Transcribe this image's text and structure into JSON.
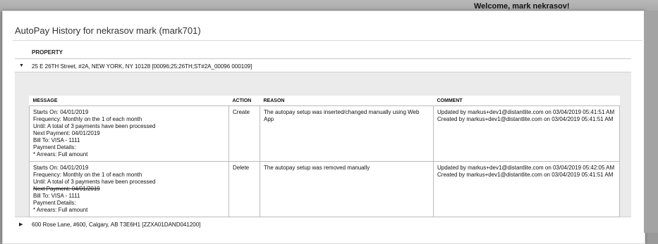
{
  "header": {
    "welcome": "Welcome, mark nekrasov!"
  },
  "modal": {
    "title": "AutoPay History for nekrasov mark (mark701)",
    "property_column_header": "PROPERTY"
  },
  "properties": [
    {
      "label": "25 E 26TH Street, #2A, NEW YORK, NY 10128 [00096;25;26TH;ST#2A_00096 000109]",
      "expanded": true
    },
    {
      "label": "600 Rose Lane, #600, Calgary, AB T3E6H1 [ZZXA01DAND041200]",
      "expanded": false
    }
  ],
  "history_table": {
    "columns": [
      "MESSAGE",
      "ACTION",
      "REASON",
      "COMMENT"
    ],
    "rows": [
      {
        "message": {
          "starts_on": "Starts On: 04/01/2019",
          "frequency": "Frequency: Monthly on the 1 of each month",
          "until": "Until: A total of 3 payments have been processed",
          "next_payment": "Next Payment: 04/01/2019",
          "bill_to": "Bill To: VISA - 1111",
          "payment_details": "Payment Details:",
          "arrears": "* Arrears: Full amount"
        },
        "action": "Create",
        "reason": "The autopay setup was inserted/changed manually using Web App",
        "comment_updated": "Updated by markus+dev1@distantlite.com on 03/04/2019 05:41:51 AM",
        "comment_created": "Created by markus+dev1@distantlite.com on 03/04/2019 05:41:51 AM"
      },
      {
        "message": {
          "starts_on": "Starts On: 04/01/2019",
          "frequency": "Frequency: Monthly on the 1 of each month",
          "until": "Until: A total of 3 payments have been processed",
          "next_payment": "Next Payment: 04/01/2019",
          "bill_to": "Bill To: VISA - 1111",
          "payment_details": "Payment Details:",
          "arrears": "* Arrears: Full amount"
        },
        "action": "Delete",
        "reason": "The autopay setup was removed manually",
        "comment_updated": "Updated by markus+dev1@distantlite.com on 03/04/2019 05:42:05 AM",
        "comment_created": "Created by markus+dev1@distantlite.com on 03/04/2019 05:41:51 AM"
      }
    ]
  }
}
